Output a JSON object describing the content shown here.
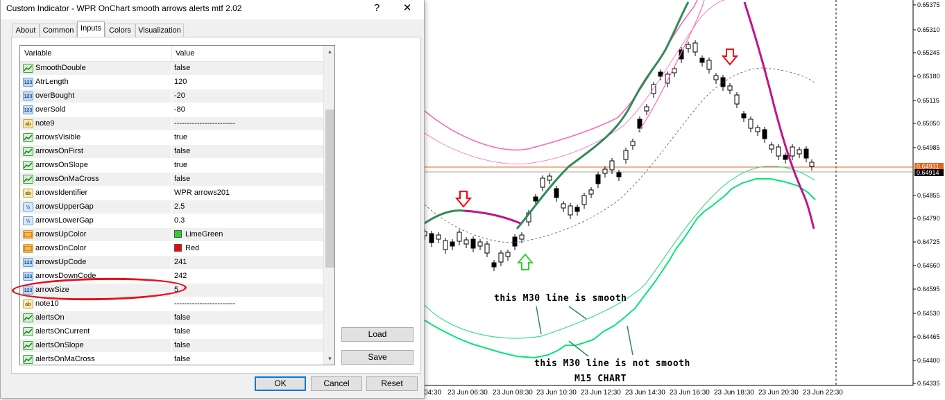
{
  "dialog": {
    "title": "Custom Indicator - WPR OnChart smooth arrows alerts mtf 2.02",
    "help_label": "?",
    "close_label": "✕",
    "tabs": [
      "About",
      "Common",
      "Inputs",
      "Colors",
      "Visualization"
    ],
    "active_tab": "Inputs",
    "columns": [
      "Variable",
      "Value"
    ],
    "rows": [
      {
        "icon": "bool",
        "name": "SmoothDouble",
        "value": "false"
      },
      {
        "icon": "num",
        "name": "AtrLength",
        "value": "120"
      },
      {
        "icon": "num",
        "name": "overBought",
        "value": "-20"
      },
      {
        "icon": "num",
        "name": "overSold",
        "value": "-80"
      },
      {
        "icon": "ab",
        "name": "note9",
        "value": "------------------------"
      },
      {
        "icon": "bool",
        "name": "arrowsVisible",
        "value": "true"
      },
      {
        "icon": "bool",
        "name": "arrowsOnFirst",
        "value": "false"
      },
      {
        "icon": "bool",
        "name": "arrowsOnSlope",
        "value": "true"
      },
      {
        "icon": "bool",
        "name": "arrowsOnMaCross",
        "value": "false"
      },
      {
        "icon": "ab",
        "name": "arrowsIdentifier",
        "value": "WPR arrows201"
      },
      {
        "icon": "dbl",
        "name": "arrowsUpperGap",
        "value": "2.5"
      },
      {
        "icon": "dbl",
        "name": "arrowsLowerGap",
        "value": "0.3"
      },
      {
        "icon": "clr",
        "name": "arrowsUpColor",
        "value": "LimeGreen",
        "swatch": "#32cd32"
      },
      {
        "icon": "clr",
        "name": "arrowsDnColor",
        "value": "Red",
        "swatch": "#ff0000"
      },
      {
        "icon": "num",
        "name": "arrowsUpCode",
        "value": "241"
      },
      {
        "icon": "num",
        "name": "arrowsDownCode",
        "value": "242"
      },
      {
        "icon": "num",
        "name": "arrowSize",
        "value": "5"
      },
      {
        "icon": "ab",
        "name": "note10",
        "value": "------------------------"
      },
      {
        "icon": "bool",
        "name": "alertsOn",
        "value": "false"
      },
      {
        "icon": "bool",
        "name": "alertsOnCurrent",
        "value": "false"
      },
      {
        "icon": "bool",
        "name": "alertsOnSlope",
        "value": "false"
      },
      {
        "icon": "bool",
        "name": "alertsOnMaCross",
        "value": "false"
      }
    ],
    "icon_text": {
      "num": "123",
      "ab": "ab",
      "bool": "",
      "dbl": "½",
      "clr": ""
    },
    "load_label": "Load",
    "save_label": "Save",
    "ok_label": "OK",
    "cancel_label": "Cancel",
    "reset_label": "Reset"
  },
  "chart": {
    "price_labels": [
      "0.65375",
      "0.65310",
      "0.65245",
      "0.65180",
      "0.65115",
      "0.65050",
      "0.64985",
      "0.64855",
      "0.64790",
      "0.64725",
      "0.64660",
      "0.64595",
      "0.64530",
      "0.64465",
      "0.64400",
      "0.64335"
    ],
    "price_tags": [
      {
        "label": "0.64931",
        "color": "#e8641e"
      },
      {
        "label": "0.64914",
        "color": "#000000"
      }
    ],
    "time_labels": [
      "04:30",
      "23 Jun 06:30",
      "23 Jun 08:30",
      "23 Jun 10:30",
      "23 Jun 12:30",
      "23 Jun 14:30",
      "23 Jun 16:30",
      "23 Jun 18:30",
      "23 Jun 20:30",
      "23 Jun 22:30"
    ],
    "annotations": [
      "this M30 line is smooth",
      "this M30 line is not smooth",
      "M15 CHART"
    ],
    "colors": {
      "up_line": "#2e8b57",
      "down_line": "#c0158a",
      "band_pink": "#ff69b4",
      "band_green": "#00e676",
      "smooth_green": "#3ce08a",
      "current_price": "#e8641e",
      "arrow_up": "#32cd32",
      "arrow_down": "#ff0000"
    }
  }
}
